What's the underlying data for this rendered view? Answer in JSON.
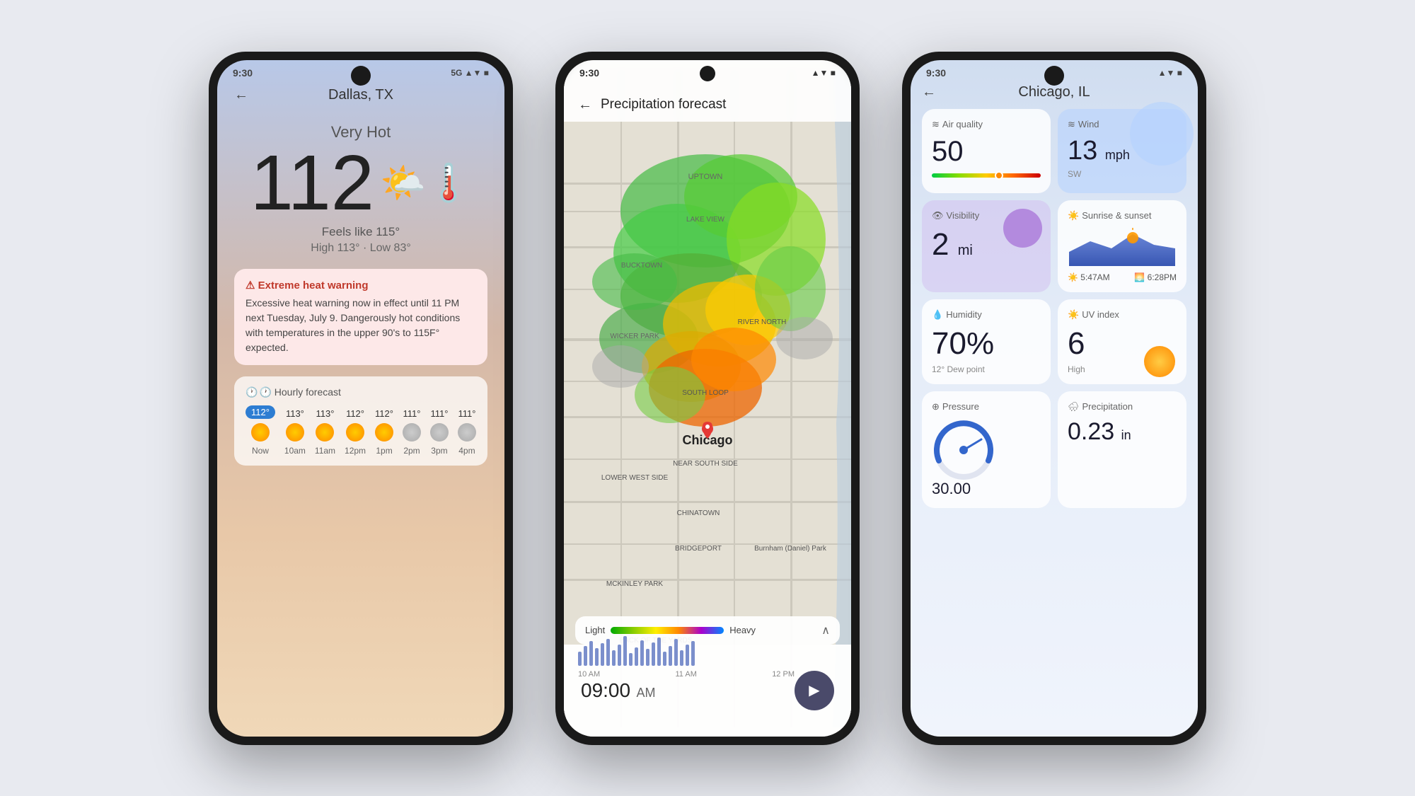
{
  "background_color": "#e8eaf0",
  "phone1": {
    "status_time": "9:30",
    "status_right": "5G ▲▼",
    "city": "Dallas, TX",
    "condition": "Very Hot",
    "temperature": "112",
    "weather_emoji": "🌤️🌡️",
    "feels_like": "Feels like 115°",
    "high_low": "High 113° · Low 83°",
    "alert_title": "⚠ Extreme heat warning",
    "alert_text": "Excessive heat warning now in effect until 11 PM next Tuesday, July 9. Dangerously hot conditions with temperatures in the upper 90's to 115F° expected.",
    "hourly_title": "🕐 Hourly forecast",
    "hourly": [
      {
        "time": "Now",
        "temp": "112°",
        "active": true
      },
      {
        "time": "10am",
        "temp": "113°",
        "active": false
      },
      {
        "time": "11am",
        "temp": "113°",
        "active": false
      },
      {
        "time": "12pm",
        "temp": "112°",
        "active": false
      },
      {
        "time": "1pm",
        "temp": "112°",
        "active": false
      },
      {
        "time": "2pm",
        "temp": "111°",
        "active": false
      },
      {
        "time": "3pm",
        "temp": "111°",
        "active": false
      },
      {
        "time": "4pm",
        "temp": "111°",
        "active": false
      }
    ]
  },
  "phone2": {
    "status_time": "9:30",
    "header_title": "Precipitation forecast",
    "map_city": "Chicago",
    "time_display": "09:00",
    "time_ampm": "AM",
    "legend_light": "Light",
    "legend_heavy": "Heavy",
    "timeline_labels": [
      "10 AM",
      "11 AM",
      "12 PM"
    ]
  },
  "phone3": {
    "status_time": "9:30",
    "city": "Chicago, IL",
    "air_quality_title": "Air quality",
    "air_quality_value": "50",
    "wind_title": "Wind",
    "wind_value": "13",
    "wind_unit": "mph",
    "wind_dir": "SW",
    "visibility_title": "Visibility",
    "visibility_value": "2",
    "visibility_unit": "mi",
    "sunrise_title": "Sunrise & sunset",
    "sunrise_time": "5:47AM",
    "sunset_time": "6:28PM",
    "humidity_title": "Humidity",
    "humidity_value": "70%",
    "humidity_sub": "12° Dew point",
    "uv_title": "UV index",
    "uv_value": "6",
    "uv_label": "High",
    "pressure_title": "Pressure",
    "pressure_value": "30.00",
    "precip_title": "Precipitation",
    "precip_value": "0.23",
    "precip_unit": "in"
  }
}
